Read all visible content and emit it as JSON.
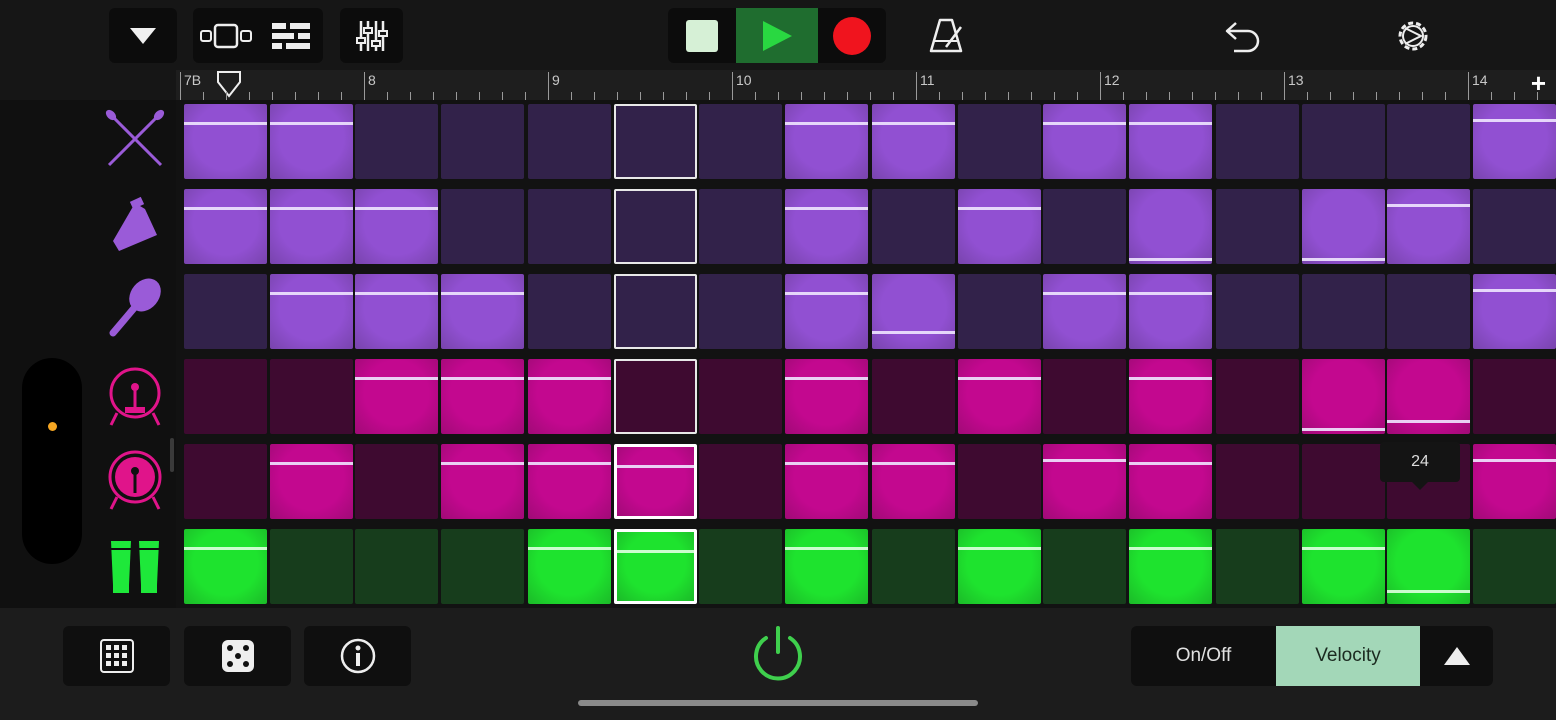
{
  "toolbar": {
    "buttons": [
      {
        "name": "browser-dropdown-icon"
      },
      {
        "name": "tracks-view-icon"
      },
      {
        "name": "live-loops-view-icon"
      },
      {
        "name": "mixer-icon"
      },
      {
        "name": "stop-icon"
      },
      {
        "name": "play-icon"
      },
      {
        "name": "record-icon"
      },
      {
        "name": "metronome-icon"
      },
      {
        "name": "undo-icon"
      },
      {
        "name": "settings-icon"
      }
    ],
    "colors": {
      "play_bg": "#1f6d2f",
      "play": "#29d841",
      "record": "#f0141e",
      "stop": "#d6f0d6"
    }
  },
  "ruler": {
    "labels": [
      "7B",
      "8",
      "9",
      "10",
      "11",
      "12",
      "13",
      "14"
    ],
    "add_label": "+"
  },
  "instruments": [
    {
      "name": "drumsticks-icon",
      "color": "#9a5bd8"
    },
    {
      "name": "cowbell-icon",
      "color": "#9a5bd8"
    },
    {
      "name": "maraca-icon",
      "color": "#9a5bd8"
    },
    {
      "name": "bass-drum-icon",
      "color": "#e0148a"
    },
    {
      "name": "bass-drum-filled-icon",
      "color": "#e0148a"
    },
    {
      "name": "congas-icon",
      "color": "#1ee83a"
    }
  ],
  "grid": {
    "rows": [
      {
        "color": "purple",
        "cells": [
          1,
          1,
          0,
          0,
          0,
          0,
          0,
          1,
          1,
          0,
          1,
          1,
          0,
          0,
          0,
          1
        ]
      },
      {
        "color": "purple",
        "cells": [
          1,
          1,
          1,
          0,
          0,
          0,
          0,
          1,
          0,
          1,
          0,
          1,
          0,
          1,
          1,
          0
        ]
      },
      {
        "color": "purple",
        "cells": [
          0,
          1,
          1,
          1,
          0,
          0,
          0,
          1,
          1,
          0,
          1,
          1,
          0,
          0,
          0,
          1
        ]
      },
      {
        "color": "magenta",
        "cells": [
          0,
          0,
          1,
          1,
          1,
          0,
          0,
          1,
          0,
          1,
          0,
          1,
          0,
          1,
          1,
          0
        ]
      },
      {
        "color": "magenta",
        "cells": [
          0,
          1,
          0,
          1,
          1,
          1,
          0,
          1,
          1,
          0,
          1,
          1,
          0,
          0,
          0,
          1
        ]
      },
      {
        "color": "green",
        "cells": [
          1,
          0,
          0,
          0,
          1,
          1,
          0,
          1,
          0,
          1,
          0,
          1,
          0,
          1,
          1,
          0
        ]
      }
    ],
    "velocities": [
      [
        0.95,
        0.95,
        0,
        0,
        0,
        0,
        0,
        0.95,
        0.95,
        0,
        0.95,
        0.95,
        0,
        0,
        0,
        0.99
      ],
      [
        0.95,
        0.95,
        0.95,
        0,
        0,
        0,
        0,
        0.95,
        0,
        0.95,
        0,
        0.24,
        0,
        0.24,
        0.99,
        0
      ],
      [
        0,
        0.95,
        0.95,
        0.95,
        0,
        0,
        0,
        0.95,
        0.4,
        0,
        0.95,
        0.95,
        0,
        0,
        0,
        0.99
      ],
      [
        0,
        0,
        0.95,
        0.95,
        0.95,
        0,
        0,
        0.95,
        0,
        0.95,
        0,
        0.95,
        0,
        0.24,
        0.35,
        0
      ],
      [
        0,
        0.95,
        0,
        0.95,
        0.95,
        0.95,
        0,
        0.95,
        0.95,
        0,
        0.99,
        0.95,
        0,
        0,
        0,
        0.99
      ],
      [
        0.95,
        0,
        0,
        0,
        0.95,
        0.95,
        0,
        0.95,
        0,
        0.95,
        0,
        0.95,
        0,
        0.95,
        0.35,
        0
      ]
    ],
    "selected_column": 5,
    "tooltip_value": "24",
    "palette": {
      "purple_on": "#9150d2",
      "purple_off": "#32224a",
      "magenta_on": "#c3088f",
      "magenta_off": "#3e0a30",
      "green_on": "#1ee32e",
      "green_off": "#173d1c"
    }
  },
  "bottom": {
    "buttons": [
      {
        "name": "grid-icon"
      },
      {
        "name": "dice-icon"
      },
      {
        "name": "info-icon"
      },
      {
        "name": "power-icon"
      }
    ],
    "segment": {
      "on_off": "On/Off",
      "velocity": "Velocity"
    },
    "expand_icon": "triangle-up-icon",
    "colors": {
      "velocity_bg": "#a3d7b8",
      "power": "#3fcf4d"
    }
  }
}
